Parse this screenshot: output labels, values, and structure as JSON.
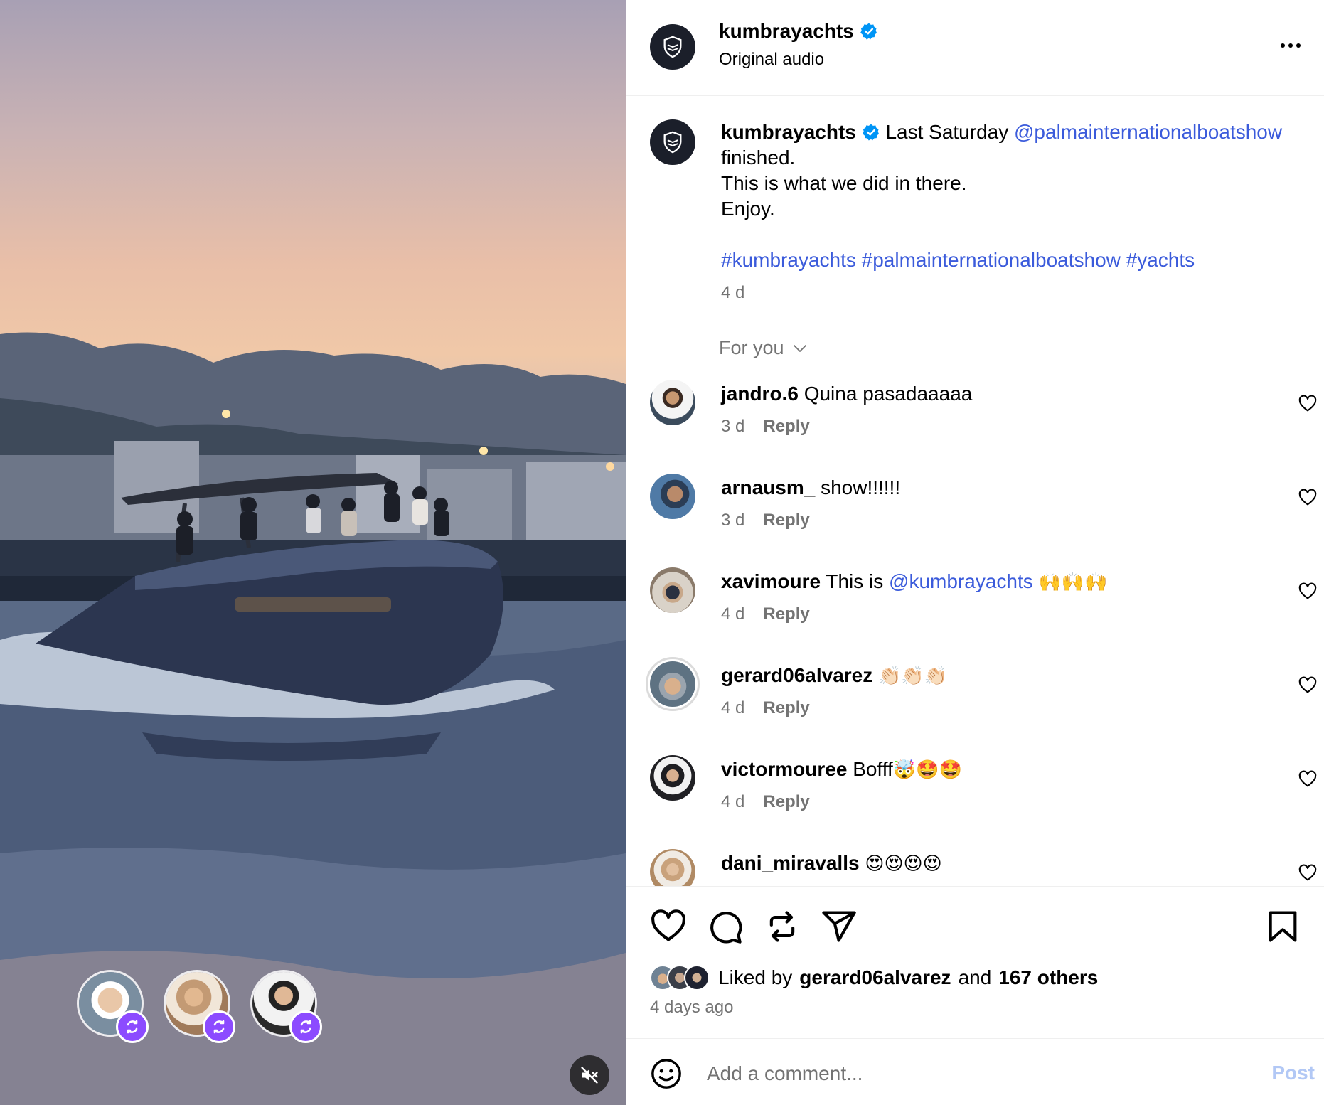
{
  "header": {
    "username": "kumbrayachts",
    "subtitle": "Original audio",
    "verified": true
  },
  "caption": {
    "username": "kumbrayachts",
    "text_before_mention": "Last Saturday",
    "mention": "@palmainternationalboatshow",
    "line1_end": "finished.",
    "line2": "This is what we did in there.",
    "line3": "Enjoy.",
    "hashtags": "#kumbrayachts #palmainternationalboatshow #yachts",
    "time": "4 d"
  },
  "filter": {
    "label": "For you"
  },
  "comments": [
    {
      "username": "jandro.6",
      "text": "Quina pasadaaaaa",
      "time": "3 d",
      "reply": "Reply"
    },
    {
      "username": "arnausm_",
      "text": "show!!!!!!",
      "time": "3 d",
      "reply": "Reply"
    },
    {
      "username": "xavimoure",
      "text": "This is",
      "mention": "@kumbrayachts",
      "emoji": "🙌🙌🙌",
      "time": "4 d",
      "reply": "Reply"
    },
    {
      "username": "gerard06alvarez",
      "text": "",
      "emoji": "👏🏻👏🏻👏🏻",
      "time": "4 d",
      "reply": "Reply"
    },
    {
      "username": "victormouree",
      "text": "Bofff",
      "emoji": "🤯🤩🤩",
      "time": "4 d",
      "reply": "Reply"
    },
    {
      "username": "dani_miravalls",
      "text": "",
      "emoji": "😍😍😍😍",
      "time": "",
      "reply": ""
    }
  ],
  "likes": {
    "prefix": "Liked by",
    "user": "gerard06alvarez",
    "middle": "and",
    "others": "167 others"
  },
  "post_time": "4 days ago",
  "comment_box": {
    "placeholder": "Add a comment...",
    "post_label": "Post"
  },
  "colors": {
    "link": "#3b5bdb",
    "verified": "#0095f6",
    "remix_badge": "#8c4bff",
    "muted_text": "#737373"
  }
}
